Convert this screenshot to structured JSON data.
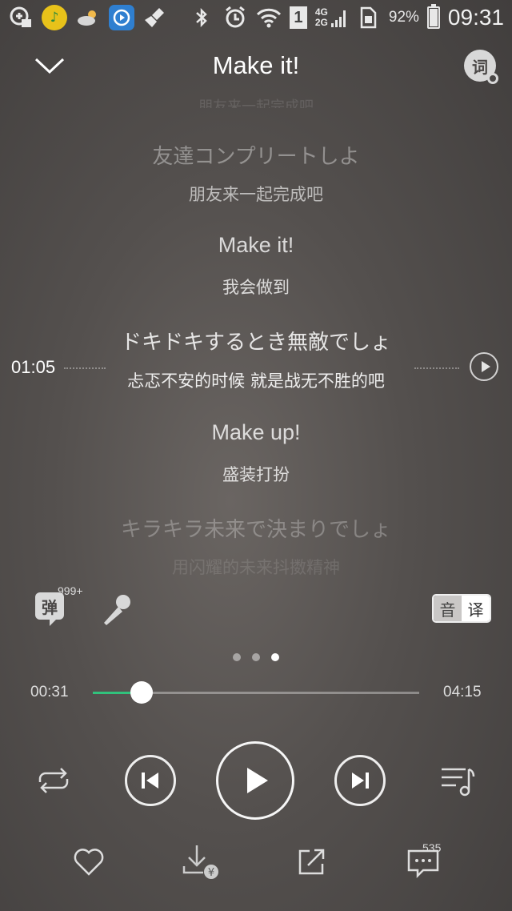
{
  "status_bar": {
    "network_top": "4G",
    "network_bottom": "2G",
    "sim_slot": "1",
    "battery_percent": "92%",
    "time": "09:31",
    "icons": [
      "qq-music-add-icon",
      "qq-music-app-icon",
      "weather-cloud-icon",
      "video-app-icon",
      "broom-clean-icon",
      "bluetooth-icon",
      "alarm-icon",
      "wifi-icon",
      "sim-1-icon",
      "cell-signal-icon",
      "sim-card-icon",
      "battery-icon"
    ]
  },
  "header": {
    "title": "Make it!",
    "lyric_search_label": "词"
  },
  "lyrics": {
    "lines": [
      {
        "original": "友達コンプリートしよ",
        "translation": "朋友来一起完成吧"
      },
      {
        "original": "Make it!",
        "translation": "我会做到"
      },
      {
        "original": "ドキドキするとき無敵でしょ",
        "translation": "忐忑不安的时候 就是战无不胜的吧"
      },
      {
        "original": "Make up!",
        "translation": "盛装打扮"
      },
      {
        "original": "キラキラ未来で決まりでしょ",
        "translation": "用闪耀的未来抖擞精神"
      }
    ],
    "active_index": 2,
    "seek_time": "01:05"
  },
  "tools": {
    "danmaku_label": "弹",
    "danmaku_count": "999+",
    "lang_original": "音",
    "lang_translation": "译"
  },
  "pager": {
    "count": 3,
    "active": 2
  },
  "player": {
    "current_time": "00:31",
    "total_time": "04:15",
    "progress": 0.149,
    "accent_color": "#31c27c",
    "state": "paused"
  },
  "actions": {
    "comment_count": "535",
    "icons": [
      "heart-icon",
      "download-paid-icon",
      "share-icon",
      "comment-icon"
    ]
  }
}
